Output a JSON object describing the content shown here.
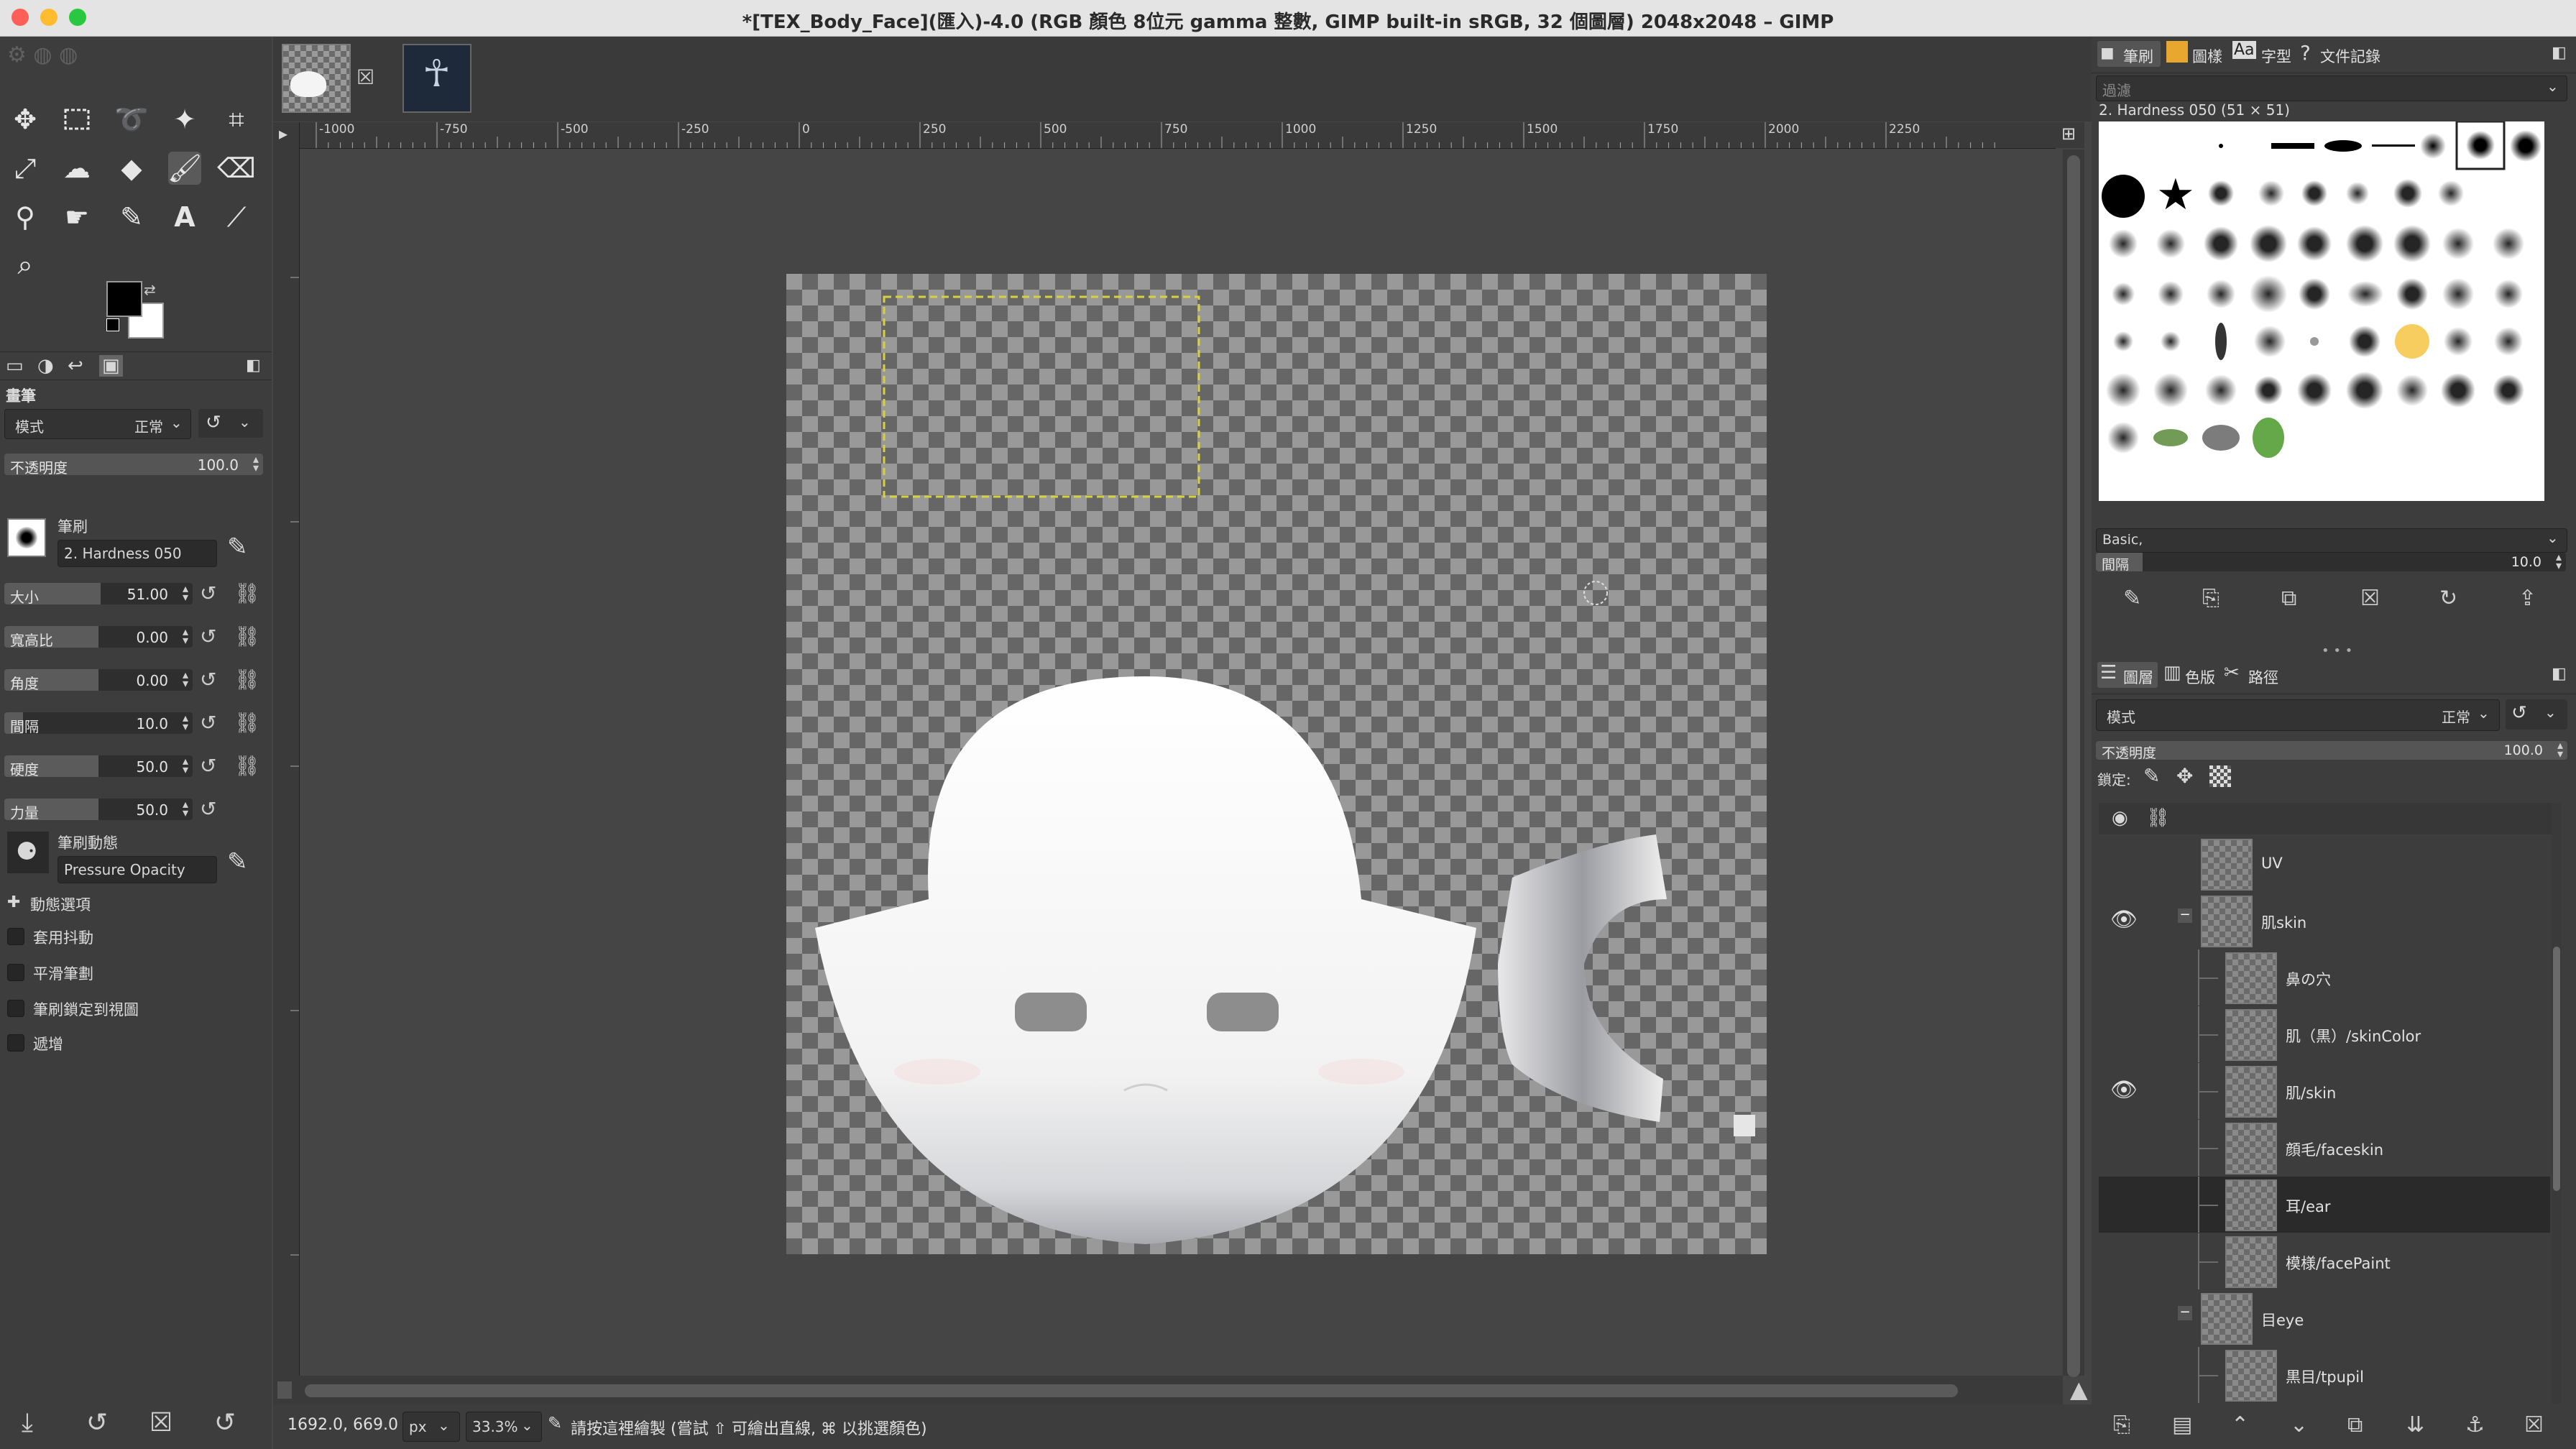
{
  "window": {
    "title": "*[TEX_Body_Face](匯入)-4.0 (RGB 顏色 8位元 gamma 整數, GIMP built-in sRGB, 32 個圖層) 2048x2048 – GIMP",
    "traffic_lights": [
      "#fe5f57",
      "#febc2e",
      "#28c840"
    ]
  },
  "toolbox": {
    "tools": [
      "move-tool",
      "rect-select-tool",
      "free-select-tool",
      "fuzzy-select-tool",
      "crop-tool",
      "transform-tool",
      "warp-tool",
      "bucket-fill-tool",
      "paintbrush-tool",
      "eraser-tool",
      "clone-tool",
      "smudge-tool",
      "paths-tool",
      "text-tool",
      "color-picker-tool",
      "zoom-tool"
    ],
    "fg_color": "#000000",
    "bg_color": "#ffffff"
  },
  "tool_options": {
    "section_title": "畫筆",
    "mode_label": "模式",
    "mode_value": "正常",
    "opacity_label": "不透明度",
    "opacity_value": "100.0",
    "brush_label": "筆刷",
    "brush_name": "2. Hardness 050",
    "sliders": [
      {
        "label": "大小",
        "value": "51.00",
        "fill": 0.51
      },
      {
        "label": "寬高比",
        "value": "0.00",
        "fill": 0.5
      },
      {
        "label": "角度",
        "value": "0.00",
        "fill": 0.5
      },
      {
        "label": "間隔",
        "value": "10.0",
        "fill": 0.1
      },
      {
        "label": "硬度",
        "value": "50.0",
        "fill": 0.5
      },
      {
        "label": "力量",
        "value": "50.0",
        "fill": 0.5
      }
    ],
    "dynamics_label": "筆刷動態",
    "dynamics_value": "Pressure Opacity",
    "dynamics_options_label": "動態選項",
    "checkboxes": [
      "套用抖動",
      "平滑筆劃",
      "筆刷鎖定到視圖",
      "遞增"
    ]
  },
  "image_tabs": [
    "face-texture-tab",
    "body-texture-tab"
  ],
  "ruler": {
    "labels": [
      "-1000",
      "-750",
      "-500",
      "-250",
      "0",
      "250",
      "500",
      "750",
      "1000",
      "1250",
      "1500",
      "1750",
      "2000",
      "2250"
    ]
  },
  "statusbar": {
    "coords": "1692.0, 669.0",
    "unit": "px",
    "zoom": "33.3%",
    "message": "請按這裡繪製 (嘗試 ⇧ 可繪出直線, ⌘ 以挑選顏色)"
  },
  "brushes_panel": {
    "tabs": [
      "筆刷",
      "圖樣",
      "字型",
      "文件記錄"
    ],
    "filter_placeholder": "過濾",
    "selected_brush": "2. Hardness 050 (51 × 51)",
    "tag_value": "Basic,",
    "spacing_label": "間隔",
    "spacing_value": "10.0"
  },
  "layers_panel": {
    "tabs": [
      "圖層",
      "色版",
      "路徑"
    ],
    "mode_label": "模式",
    "mode_value": "正常",
    "opacity_label": "不透明度",
    "opacity_value": "100.0",
    "lock_label": "鎖定:",
    "layers": [
      {
        "name": "UV",
        "visible": false,
        "indent": 0,
        "group": false
      },
      {
        "name": "肌skin",
        "visible": true,
        "indent": 0,
        "group": true
      },
      {
        "name": "鼻の穴",
        "visible": false,
        "indent": 1,
        "group": false
      },
      {
        "name": "肌（黒）/skinColor",
        "visible": false,
        "indent": 1,
        "group": false
      },
      {
        "name": "肌/skin",
        "visible": true,
        "indent": 1,
        "group": false
      },
      {
        "name": "顔毛/faceskin",
        "visible": false,
        "indent": 1,
        "group": false
      },
      {
        "name": "耳/ear",
        "visible": false,
        "indent": 1,
        "group": false,
        "selected": true
      },
      {
        "name": "模様/facePaint",
        "visible": false,
        "indent": 1,
        "group": false
      },
      {
        "name": "目eye",
        "visible": false,
        "indent": 0,
        "group": true
      },
      {
        "name": "黒目/tpupil",
        "visible": false,
        "indent": 1,
        "group": false
      }
    ]
  }
}
